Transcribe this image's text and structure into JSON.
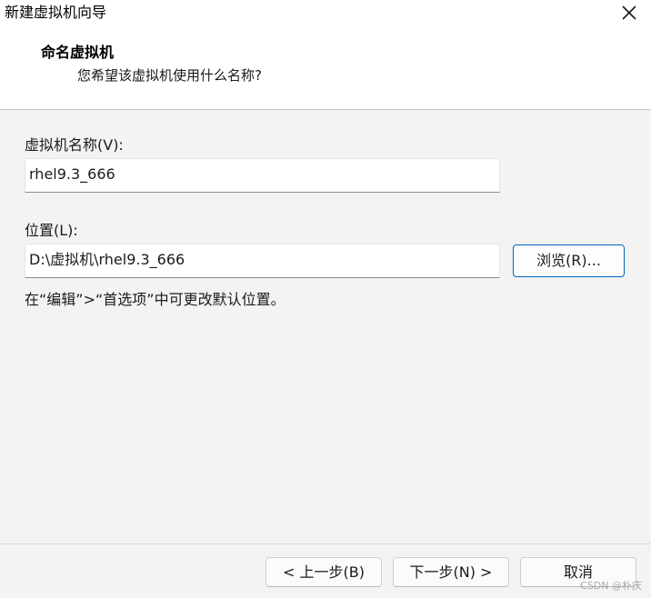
{
  "window": {
    "title": "新建虚拟机向导",
    "close_icon": "close-icon"
  },
  "header": {
    "title": "命名虚拟机",
    "subtitle": "您希望该虚拟机使用什么名称?"
  },
  "form": {
    "vm_name_label": "虚拟机名称(V):",
    "vm_name_value": "rhel9.3_666",
    "location_label": "位置(L):",
    "location_value": "D:\\虚拟机\\rhel9.3_666",
    "browse_label": "浏览(R)...",
    "hint": "在“编辑”>“首选项”中可更改默认位置。"
  },
  "footer": {
    "back_label": "< 上一步(B)",
    "next_label": "下一步(N) >",
    "cancel_label": "取消"
  },
  "watermark": "CSDN @朴庆",
  "colors": {
    "accent_border": "#0067c0",
    "background": "#f3f3f3",
    "header_background": "#ffffff"
  }
}
